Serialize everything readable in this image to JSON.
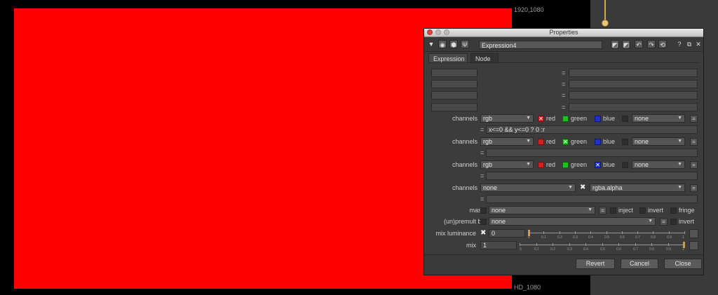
{
  "viewer": {
    "format_top": "1920,1080",
    "format_bottom": "HD_1080",
    "image_color": "#ff0000"
  },
  "window": {
    "title": "Properties"
  },
  "toolbar": {
    "node_name": "Expression4",
    "help": "?"
  },
  "tabs": [
    "Expression",
    "Node"
  ],
  "temp_rows": [
    {
      "eq": "="
    },
    {
      "eq": "="
    },
    {
      "eq": "="
    },
    {
      "eq": "="
    }
  ],
  "channel_groups": [
    {
      "label": "channels",
      "layer": "rgb",
      "c1": "red",
      "c2": "green",
      "c3": "blue",
      "c4": "none",
      "btn": "=",
      "expr_eq": "=",
      "expr": "x<=0 && y<=0 ? 0 :r",
      "checked": "red"
    },
    {
      "label": "channels",
      "layer": "rgb",
      "c1": "red",
      "c2": "green",
      "c3": "blue",
      "c4": "none",
      "btn": "=",
      "expr_eq": "=",
      "expr": "",
      "checked": "green"
    },
    {
      "label": "channels",
      "layer": "rgb",
      "c1": "red",
      "c2": "green",
      "c3": "blue",
      "c4": "none",
      "btn": "=",
      "expr_eq": "=",
      "expr": "",
      "checked": "blue"
    }
  ],
  "alpha_group": {
    "label": "channels",
    "layer": "none",
    "alpha": "rgba.alpha",
    "btn": "=",
    "expr_eq": "=",
    "expr": ""
  },
  "mask": {
    "label": "mask",
    "value": "none",
    "btn": "=",
    "inject": "inject",
    "invert": "invert",
    "fringe": "fringe"
  },
  "unpremult": {
    "label": "(un)premult by",
    "value": "none",
    "btn": "=",
    "invert": "invert"
  },
  "mix_luminance": {
    "label": "mix luminance",
    "value": "0",
    "ticks": [
      "0",
      "0.1",
      "0.2",
      "0.3",
      "0.4",
      "0.5",
      "0.6",
      "0.7",
      "0.8",
      "0.9",
      "1"
    ],
    "level": 0
  },
  "mix": {
    "label": "mix",
    "value": "1",
    "ticks": [
      "0",
      "0.1",
      "0.2",
      "0.3",
      "0.4",
      "0.5",
      "0.6",
      "0.7",
      "0.8",
      "0.9",
      "1"
    ],
    "level": 1
  },
  "footer": {
    "revert": "Revert",
    "cancel": "Cancel",
    "close": "Close"
  },
  "icons": [
    "collapse-arrow-icon",
    "node-color-icon",
    "node-group-icon",
    "wrench-icon",
    "float-icon",
    "close-icon"
  ]
}
